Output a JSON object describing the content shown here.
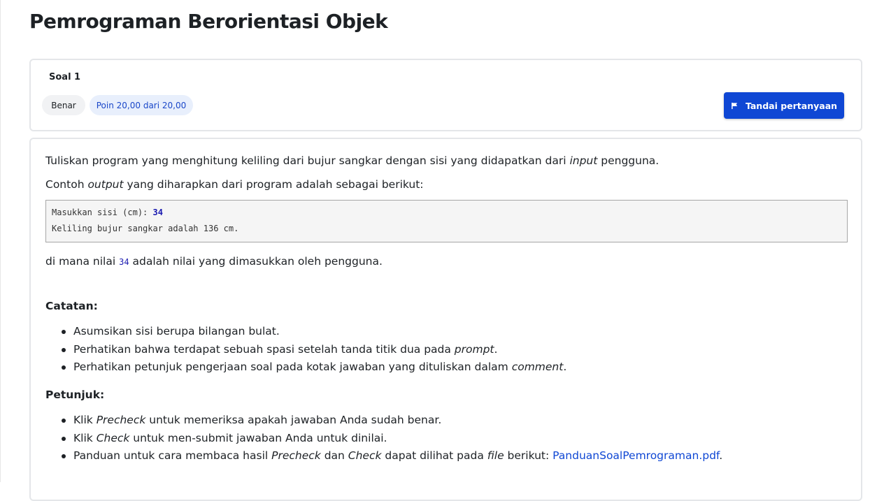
{
  "page": {
    "title": "Pemrograman Berorientasi Objek"
  },
  "question": {
    "number_label": "Soal 1",
    "status": "Benar",
    "points": "Poin 20,00 dari 20,00",
    "flag_button": "Tandai pertanyaan",
    "flag_icon": "flag-icon"
  },
  "content": {
    "p1": {
      "a": "Tuliskan program yang menghitung keliling dari bujur sangkar dengan sisi yang didapatkan dari ",
      "em": "input",
      "b": " pengguna."
    },
    "p2": {
      "a": "Contoh ",
      "em": "output",
      "b": " yang diharapkan dari program adalah sebagai berikut:"
    },
    "code": {
      "line1_prefix": "Masukkan sisi (cm): ",
      "line1_value": "34",
      "line2": "Keliling bujur sangkar adalah 136 cm."
    },
    "p3": {
      "a": "di mana nilai ",
      "code": "34",
      "b": " adalah nilai yang dimasukkan oleh pengguna."
    },
    "catatan_heading": "Catatan:",
    "catatan": [
      {
        "a": "Asumsikan sisi berupa bilangan bulat.",
        "em": "",
        "b": ""
      },
      {
        "a": "Perhatikan bahwa terdapat sebuah spasi setelah tanda titik dua pada ",
        "em": "prompt",
        "b": "."
      },
      {
        "a": "Perhatikan petunjuk pengerjaan soal pada kotak jawaban yang dituliskan dalam ",
        "em": "comment",
        "b": "."
      }
    ],
    "petunjuk_heading": "Petunjuk:",
    "petunjuk": [
      {
        "a": "Klik ",
        "em": "Precheck",
        "b": " untuk memeriksa apakah jawaban Anda sudah benar."
      },
      {
        "a": "Klik ",
        "em": "Check",
        "b": " untuk men-submit jawaban Anda untuk dinilai."
      }
    ],
    "petunjuk3": {
      "a": "Panduan untuk cara membaca hasil ",
      "em1": "Precheck",
      "b": " dan ",
      "em2": "Check",
      "c": " dapat dilihat pada ",
      "em3": "file",
      "d": " berikut: ",
      "link": "PanduanSoalPemrograman.pdf",
      "e": "."
    }
  }
}
